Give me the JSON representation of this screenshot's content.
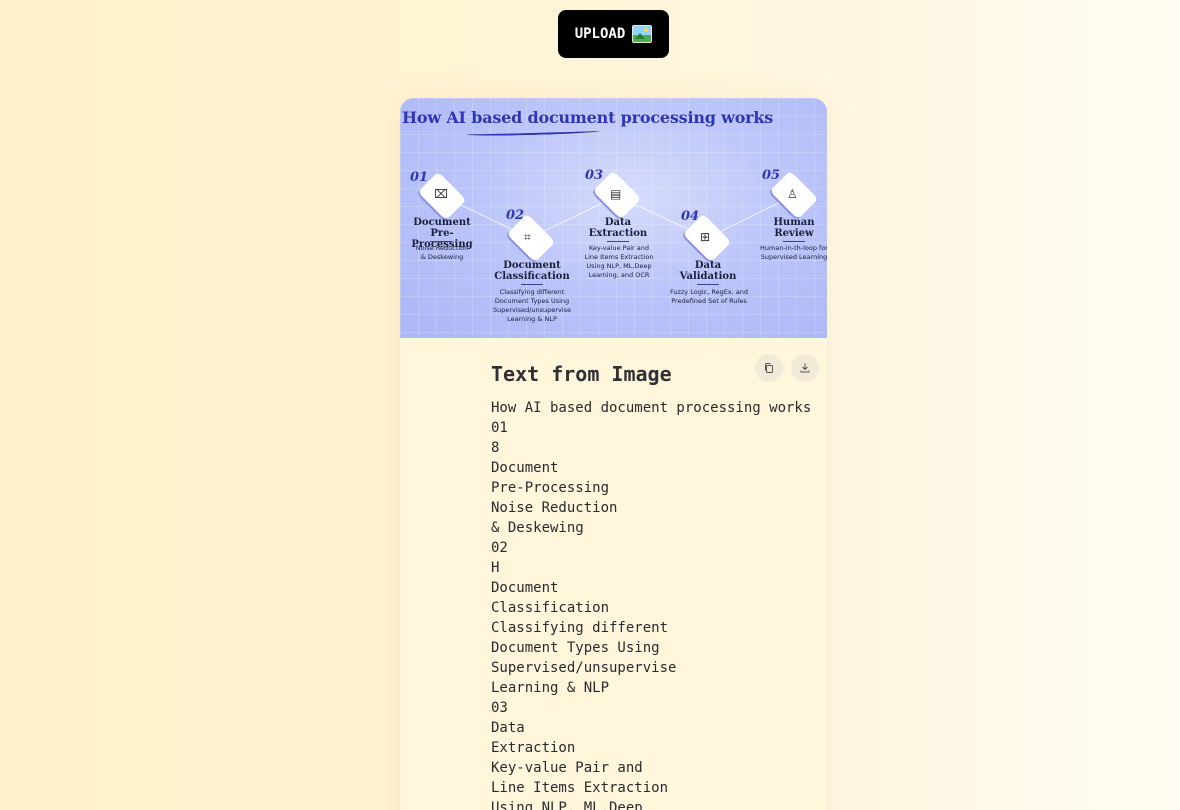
{
  "toolbar": {
    "upload_label": "UPLOAD",
    "upload_icon": "framed-picture-icon"
  },
  "infographic": {
    "title": "How AI based document processing works",
    "steps": [
      {
        "num": "01",
        "title_line1": "Document",
        "title_line2": "Pre-Processing",
        "desc_line1": "Noise Reduction",
        "desc_line2": "& Deskewing",
        "icon": "scan-document-icon"
      },
      {
        "num": "02",
        "title_line1": "Document",
        "title_line2": "Classification",
        "desc_line1": "Classifying different",
        "desc_line2": "Document Types Using",
        "desc_line3": "Supervised/unsupervise",
        "desc_line4": "Learning & NLP",
        "icon": "classification-icon"
      },
      {
        "num": "03",
        "title_line1": "Data",
        "title_line2": "Extraction",
        "desc_line1": "Key-value Pair and",
        "desc_line2": "Line Items Extraction",
        "desc_line3": "Using NLP, ML,Deep",
        "desc_line4": "Learning, and OCR",
        "icon": "extraction-icon"
      },
      {
        "num": "04",
        "title_line1": "Data",
        "title_line2": "Validation",
        "desc_line1": "Fuzzy Logic, RegEx, and",
        "desc_line2": "Predefined Set of Rules",
        "icon": "validation-icon"
      },
      {
        "num": "05",
        "title_line1": "Human",
        "title_line2": "Review",
        "desc_line1": "Human-in-th-loop for",
        "desc_line2": "Supervised Learning",
        "icon": "human-review-icon"
      }
    ]
  },
  "result": {
    "heading": "Text from Image",
    "copy_icon": "copy-icon",
    "download_icon": "download-icon",
    "lines": [
      "How AI based document processing works",
      "01",
      "8",
      "Document",
      "Pre-Processing",
      "Noise Reduction",
      "& Deskewing",
      "02",
      "H",
      "Document",
      "Classification",
      "Classifying different",
      "Document Types Using",
      "Supervised/unsupervise",
      "Learning & NLP",
      "03",
      "Data",
      "Extraction",
      "Key-value Pair and",
      "Line Items Extraction",
      "Using NLP, ML,Deep"
    ]
  }
}
